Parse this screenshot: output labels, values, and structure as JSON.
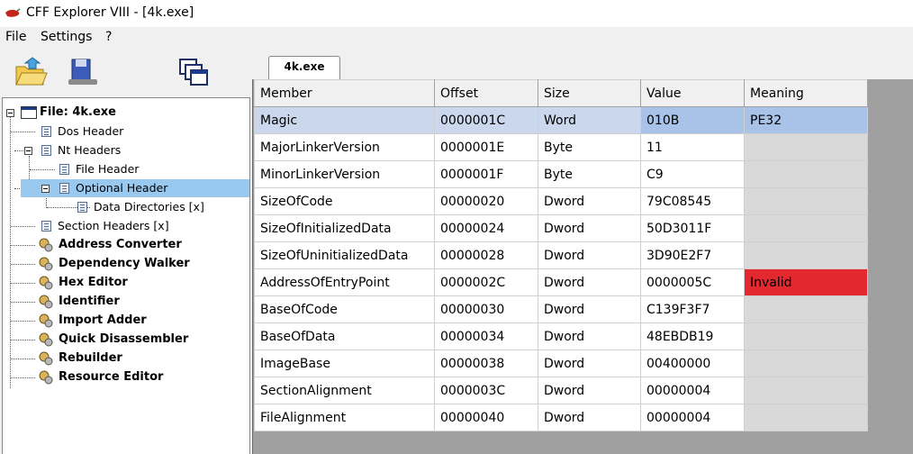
{
  "window": {
    "title": "CFF Explorer VIII - [4k.exe]"
  },
  "menu": {
    "items": [
      "File",
      "Settings",
      "?"
    ]
  },
  "tabs": [
    {
      "label": "4k.exe"
    }
  ],
  "tree": {
    "root_label": "File: 4k.exe",
    "items": [
      {
        "label": "Dos Header"
      },
      {
        "label": "Nt Headers"
      },
      {
        "label": "File Header"
      },
      {
        "label": "Optional Header"
      },
      {
        "label": "Data Directories [x]"
      },
      {
        "label": "Section Headers [x]"
      }
    ],
    "tools": [
      {
        "label": "Address Converter"
      },
      {
        "label": "Dependency Walker"
      },
      {
        "label": "Hex Editor"
      },
      {
        "label": "Identifier"
      },
      {
        "label": "Import Adder"
      },
      {
        "label": "Quick Disassembler"
      },
      {
        "label": "Rebuilder"
      },
      {
        "label": "Resource Editor"
      }
    ]
  },
  "table": {
    "columns": [
      "Member",
      "Offset",
      "Size",
      "Value",
      "Meaning"
    ],
    "rows": [
      {
        "member": "Magic",
        "offset": "0000001C",
        "size": "Word",
        "value": "010B",
        "meaning": "PE32"
      },
      {
        "member": "MajorLinkerVersion",
        "offset": "0000001E",
        "size": "Byte",
        "value": "11",
        "meaning": ""
      },
      {
        "member": "MinorLinkerVersion",
        "offset": "0000001F",
        "size": "Byte",
        "value": "C9",
        "meaning": ""
      },
      {
        "member": "SizeOfCode",
        "offset": "00000020",
        "size": "Dword",
        "value": "79C08545",
        "meaning": ""
      },
      {
        "member": "SizeOfInitializedData",
        "offset": "00000024",
        "size": "Dword",
        "value": "50D3011F",
        "meaning": ""
      },
      {
        "member": "SizeOfUninitializedData",
        "offset": "00000028",
        "size": "Dword",
        "value": "3D90E2F7",
        "meaning": ""
      },
      {
        "member": "AddressOfEntryPoint",
        "offset": "0000002C",
        "size": "Dword",
        "value": "0000005C",
        "meaning": "Invalid"
      },
      {
        "member": "BaseOfCode",
        "offset": "00000030",
        "size": "Dword",
        "value": "C139F3F7",
        "meaning": ""
      },
      {
        "member": "BaseOfData",
        "offset": "00000034",
        "size": "Dword",
        "value": "48EBDB19",
        "meaning": ""
      },
      {
        "member": "ImageBase",
        "offset": "00000038",
        "size": "Dword",
        "value": "00400000",
        "meaning": ""
      },
      {
        "member": "SectionAlignment",
        "offset": "0000003C",
        "size": "Dword",
        "value": "00000004",
        "meaning": ""
      },
      {
        "member": "FileAlignment",
        "offset": "00000040",
        "size": "Dword",
        "value": "00000004",
        "meaning": ""
      }
    ]
  },
  "colors": {
    "selection": "#99c9ef",
    "invalid": "#e3282f",
    "row_selected": "#cad7ec"
  }
}
